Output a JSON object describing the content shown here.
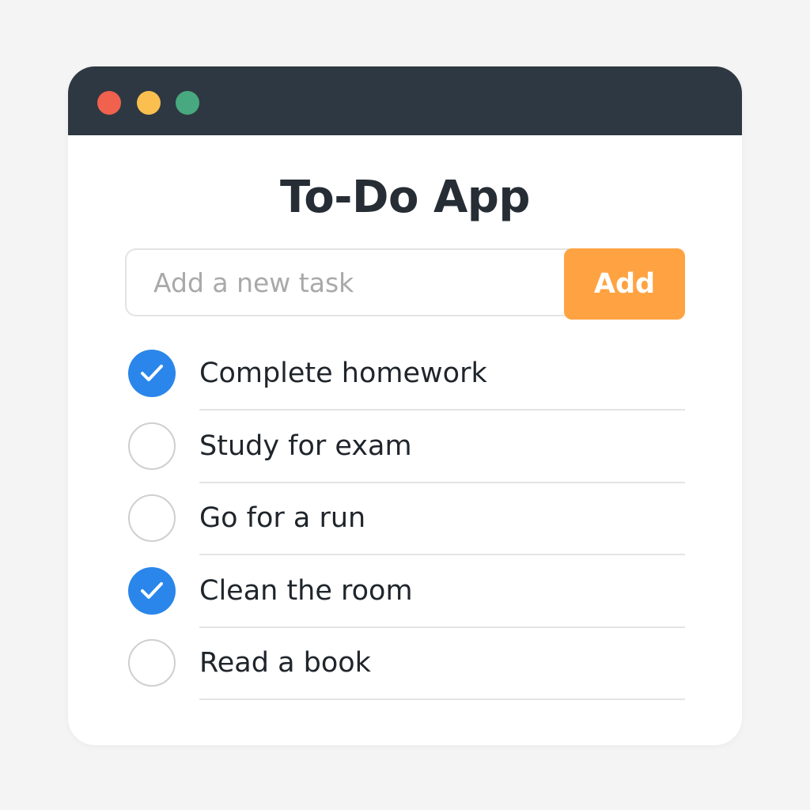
{
  "window": {
    "controls": {
      "close_color": "#f0614e",
      "minimize_color": "#fbbf4f",
      "maximize_color": "#48a980"
    },
    "titlebar_color": "#2e3842"
  },
  "app": {
    "title": "To-Do App",
    "input": {
      "placeholder": "Add a new task",
      "value": ""
    },
    "add_label": "Add",
    "accent_color": "#ffa342",
    "check_color": "#2a86ea"
  },
  "tasks": [
    {
      "label": "Complete homework",
      "checked": true
    },
    {
      "label": "Study for exam",
      "checked": false
    },
    {
      "label": "Go for a run",
      "checked": false
    },
    {
      "label": "Clean the room",
      "checked": true
    },
    {
      "label": "Read a book",
      "checked": false
    }
  ],
  "icons": {
    "checked": "check-icon"
  }
}
